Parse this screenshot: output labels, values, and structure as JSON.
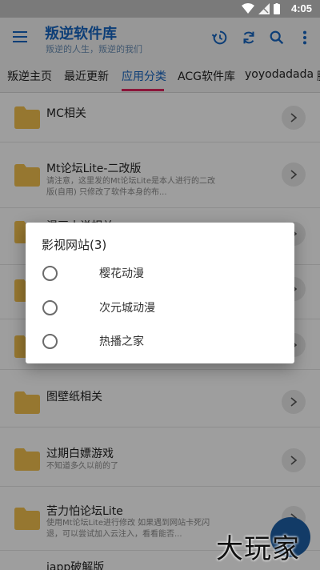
{
  "status_bar": {
    "time": "4:05"
  },
  "app_bar": {
    "title": "叛逆软件库",
    "subtitle": "叛逆的人生，叛逆的我们"
  },
  "tabs": [
    {
      "label": "叛逆主页"
    },
    {
      "label": "最近更新"
    },
    {
      "label": "应用分类"
    },
    {
      "label": "ACG软件库"
    },
    {
      "label": "yoyodadada"
    },
    {
      "label": "脚"
    }
  ],
  "list": [
    {
      "title": "MC相关",
      "desc": ""
    },
    {
      "title": "Mt论坛Lite-二改版",
      "desc": "请注意，这里发的Mt论坛Lite是本人进行的二改版(自用) 只修改了软件本身的布..."
    },
    {
      "title": "漫画小说相关",
      "desc": ""
    },
    {
      "title": "",
      "desc": ""
    },
    {
      "title": "",
      "desc": ""
    },
    {
      "title": "图壁纸相关",
      "desc": ""
    },
    {
      "title": "过期白嫖游戏",
      "desc": "不知道多久以前的了"
    },
    {
      "title": "苦力怕论坛Lite",
      "desc": "使用Mt论坛Lite进行修改 如果遇到网站卡死闪退，可以尝试加入云注入，看看能否..."
    },
    {
      "title": "iapp破解版",
      "desc": ""
    }
  ],
  "dialog": {
    "title": "影视网站(3)",
    "options": [
      {
        "label": "樱花动漫"
      },
      {
        "label": "次元城动漫"
      },
      {
        "label": "热播之家"
      }
    ]
  },
  "watermark": {
    "text": "大玩家"
  },
  "colors": {
    "accent": "#1565c0",
    "tab_indicator": "#e0245e",
    "folder": "#f2c14e",
    "fab": "#1e5fa6"
  }
}
